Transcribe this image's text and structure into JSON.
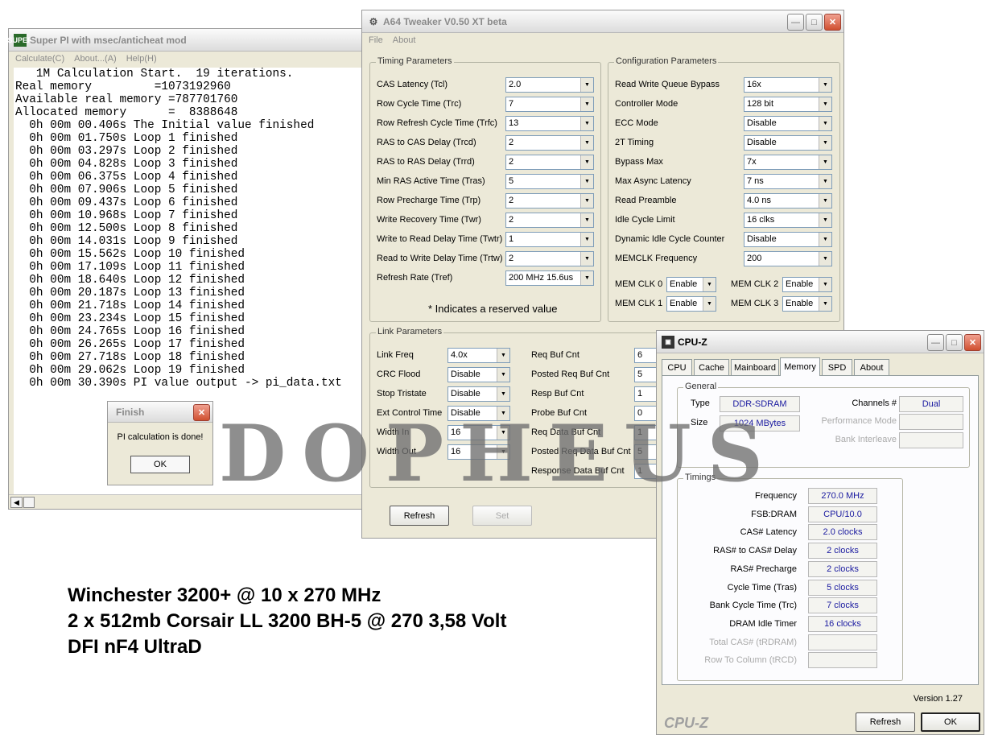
{
  "superpi": {
    "icon": "SUPER",
    "title": "Super PI with msec/anticheat mod",
    "menu": [
      "Calculate(C)",
      "About...(A)",
      "Help(H)"
    ],
    "lines": [
      "   1M Calculation Start.  19 iterations.",
      "Real memory         =1073192960",
      "Available real memory =787701760",
      "Allocated memory      =  8388648",
      "  0h 00m 00.406s The Initial value finished",
      "  0h 00m 01.750s Loop 1 finished",
      "  0h 00m 03.297s Loop 2 finished",
      "  0h 00m 04.828s Loop 3 finished",
      "  0h 00m 06.375s Loop 4 finished",
      "  0h 00m 07.906s Loop 5 finished",
      "  0h 00m 09.437s Loop 6 finished",
      "  0h 00m 10.968s Loop 7 finished",
      "  0h 00m 12.500s Loop 8 finished",
      "  0h 00m 14.031s Loop 9 finished",
      "  0h 00m 15.562s Loop 10 finished",
      "  0h 00m 17.109s Loop 11 finished",
      "  0h 00m 18.640s Loop 12 finished",
      "  0h 00m 20.187s Loop 13 finished",
      "  0h 00m 21.718s Loop 14 finished",
      "  0h 00m 23.234s Loop 15 finished",
      "  0h 00m 24.765s Loop 16 finished",
      "  0h 00m 26.265s Loop 17 finished",
      "  0h 00m 27.718s Loop 18 finished",
      "  0h 00m 29.062s Loop 19 finished",
      "  0h 00m 30.390s PI value output -> pi_data.txt"
    ]
  },
  "finish_dialog": {
    "title": "Finish",
    "message": "PI calculation is done!",
    "ok": "OK"
  },
  "a64": {
    "title": "A64 Tweaker V0.50 XT beta",
    "menu": [
      "File",
      "About"
    ],
    "timing": {
      "label": "Timing Parameters",
      "rows": [
        {
          "label": "CAS Latency (Tcl)",
          "value": "2.0"
        },
        {
          "label": "Row Cycle Time (Trc)",
          "value": "7"
        },
        {
          "label": "Row Refresh Cycle Time (Trfc)",
          "value": "13"
        },
        {
          "label": "RAS to CAS Delay (Trcd)",
          "value": "2"
        },
        {
          "label": "RAS to RAS Delay (Trrd)",
          "value": "2"
        },
        {
          "label": "Min RAS Active Time (Tras)",
          "value": "5"
        },
        {
          "label": "Row Precharge Time (Trp)",
          "value": "2"
        },
        {
          "label": "Write Recovery Time (Twr)",
          "value": "2"
        },
        {
          "label": "Write to Read Delay Time (Twtr)",
          "value": "1"
        },
        {
          "label": "Read to Write Delay Time (Trtw)",
          "value": "2"
        },
        {
          "label": "Refresh Rate (Tref)",
          "value": "200 MHz 15.6us"
        }
      ],
      "note": "* Indicates a reserved value"
    },
    "config": {
      "label": "Configuration Parameters",
      "rows": [
        {
          "label": "Read Write Queue Bypass",
          "value": "16x"
        },
        {
          "label": "Controller Mode",
          "value": "128 bit"
        },
        {
          "label": "ECC Mode",
          "value": "Disable"
        },
        {
          "label": "2T Timing",
          "value": "Disable"
        },
        {
          "label": "Bypass Max",
          "value": "7x"
        },
        {
          "label": "Max Async Latency",
          "value": "7 ns"
        },
        {
          "label": "Read Preamble",
          "value": "4.0 ns"
        },
        {
          "label": "Idle Cycle Limit",
          "value": "16 clks"
        },
        {
          "label": "Dynamic Idle Cycle Counter",
          "value": "Disable"
        },
        {
          "label": "MEMCLK Frequency",
          "value": "200"
        }
      ],
      "memclk": [
        {
          "label": "MEM CLK 0",
          "value": "Enable"
        },
        {
          "label": "MEM CLK 2",
          "value": "Enable"
        },
        {
          "label": "MEM CLK 1",
          "value": "Enable"
        },
        {
          "label": "MEM CLK 3",
          "value": "Enable"
        }
      ]
    },
    "link": {
      "label": "Link Parameters",
      "left": [
        {
          "label": "Link Freq",
          "value": "4.0x"
        },
        {
          "label": "CRC Flood",
          "value": "Disable"
        },
        {
          "label": "Stop Tristate",
          "value": "Disable"
        },
        {
          "label": "Ext Control Time",
          "value": "Disable"
        },
        {
          "label": "Width In",
          "value": "16"
        },
        {
          "label": "Width Out",
          "value": "16"
        }
      ],
      "right": [
        {
          "label": "Req Buf Cnt",
          "value": "6"
        },
        {
          "label": "Posted Req Buf Cnt",
          "value": "5"
        },
        {
          "label": "Resp Buf Cnt",
          "value": "1"
        },
        {
          "label": "Probe Buf Cnt",
          "value": "0"
        },
        {
          "label": "Req Data Buf Cnt",
          "value": "1"
        },
        {
          "label": "Posted Req Data Buf Cnt",
          "value": "5"
        },
        {
          "label": "Response Data Buf Cnt",
          "value": "1"
        }
      ]
    },
    "buttons": {
      "refresh": "Refresh",
      "set": "Set"
    }
  },
  "cpuz": {
    "title": "CPU-Z",
    "tabs": [
      "CPU",
      "Cache",
      "Mainboard",
      "Memory",
      "SPD",
      "About"
    ],
    "active_tab": "Memory",
    "general": {
      "label": "General",
      "type_label": "Type",
      "type_value": "DDR-SDRAM",
      "size_label": "Size",
      "size_value": "1024 MBytes",
      "channels_label": "Channels #",
      "channels_value": "Dual",
      "perf_label": "Performance Mode",
      "perf_value": "",
      "bank_label": "Bank Interleave",
      "bank_value": ""
    },
    "timings": {
      "label": "Timings",
      "rows": [
        {
          "label": "Frequency",
          "value": "270.0 MHz",
          "dim": false
        },
        {
          "label": "FSB:DRAM",
          "value": "CPU/10.0",
          "dim": false
        },
        {
          "label": "CAS# Latency",
          "value": "2.0 clocks",
          "dim": false
        },
        {
          "label": "RAS# to CAS# Delay",
          "value": "2 clocks",
          "dim": false
        },
        {
          "label": "RAS# Precharge",
          "value": "2 clocks",
          "dim": false
        },
        {
          "label": "Cycle Time (Tras)",
          "value": "5 clocks",
          "dim": false
        },
        {
          "label": "Bank Cycle Time (Trc)",
          "value": "7 clocks",
          "dim": false
        },
        {
          "label": "DRAM Idle Timer",
          "value": "16 clocks",
          "dim": false
        },
        {
          "label": "Total CAS# (tRDRAM)",
          "value": "",
          "dim": true
        },
        {
          "label": "Row To Column (tRCD)",
          "value": "",
          "dim": true
        }
      ]
    },
    "version": "Version 1.27",
    "brand": "CPU-Z",
    "buttons": {
      "refresh": "Refresh",
      "ok": "OK"
    }
  },
  "caption": [
    "Winchester 3200+ @ 10 x 270 MHz",
    "2 x 512mb Corsair LL 3200 BH-5 @ 270  3,58 Volt",
    "DFI nF4 UltraD"
  ],
  "watermark": "DOPHEUS"
}
